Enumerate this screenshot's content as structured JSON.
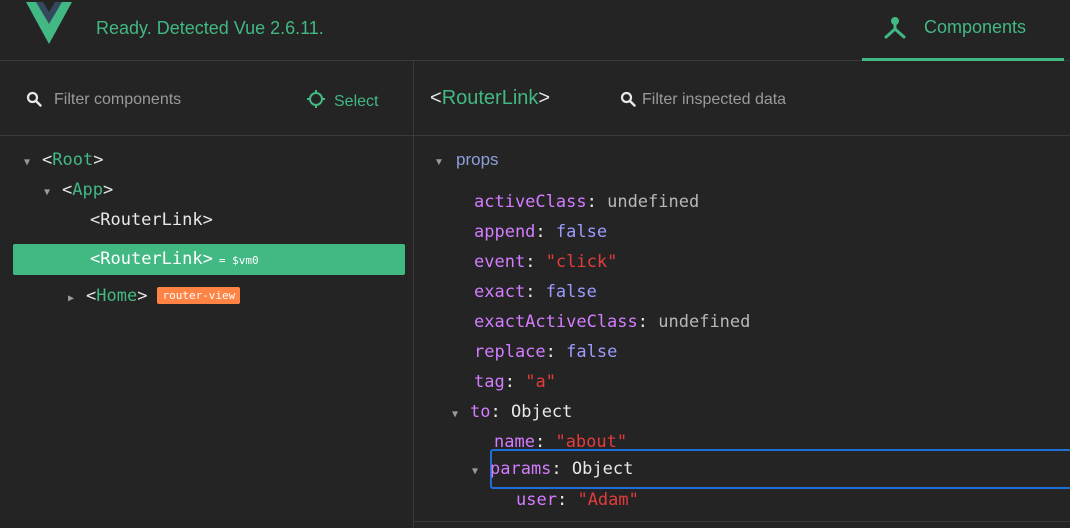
{
  "topbar": {
    "status": "Ready. Detected Vue 2.6.11.",
    "tab_components": "Components",
    "colors": {
      "accent": "#42b883",
      "logo_dark": "#35495e"
    }
  },
  "left": {
    "filter_placeholder": "Filter components",
    "select_label": "Select",
    "tree": [
      {
        "open": "<",
        "name": "Root",
        "close": ">",
        "expanded": true
      },
      {
        "open": "<",
        "name": "App",
        "close": ">",
        "expanded": true
      },
      {
        "text": "<RouterLink>"
      },
      {
        "open": "<",
        "name": "RouterLink",
        "close": ">",
        "ref": "= $vm0",
        "selected": true
      },
      {
        "open": "<",
        "name": "Home",
        "close": ">",
        "badge": "router-view",
        "expanded": false
      }
    ]
  },
  "inspector": {
    "component": {
      "open": "<",
      "name": "RouterLink",
      "close": ">"
    },
    "filter_placeholder": "Filter inspected data",
    "section": "props",
    "props": [
      {
        "key": "activeClass",
        "colon": ":",
        "value": "undefined"
      },
      {
        "key": "append",
        "colon": ":",
        "value": "false"
      },
      {
        "key": "event",
        "colon": ":",
        "value": "\"click\""
      },
      {
        "key": "exact",
        "colon": ":",
        "value": "false"
      },
      {
        "key": "exactActiveClass",
        "colon": ":",
        "value": "undefined"
      },
      {
        "key": "replace",
        "colon": ":",
        "value": "false"
      },
      {
        "key": "tag",
        "colon": ":",
        "value": "\"a\""
      },
      {
        "key": "to",
        "colon": ":",
        "value": "Object"
      },
      {
        "key": "name",
        "colon": ":",
        "value": "\"about\""
      },
      {
        "key": "params",
        "colon": ":",
        "value": "Object"
      },
      {
        "key": "user",
        "colon": ":",
        "value": "\"Adam\""
      }
    ]
  },
  "icons": {
    "logo": "vue-logo",
    "components_tab": "component-tree-icon",
    "search": "search-icon",
    "select": "target-icon",
    "expanded": "triangle-down-icon",
    "collapsed": "triangle-right-icon"
  }
}
